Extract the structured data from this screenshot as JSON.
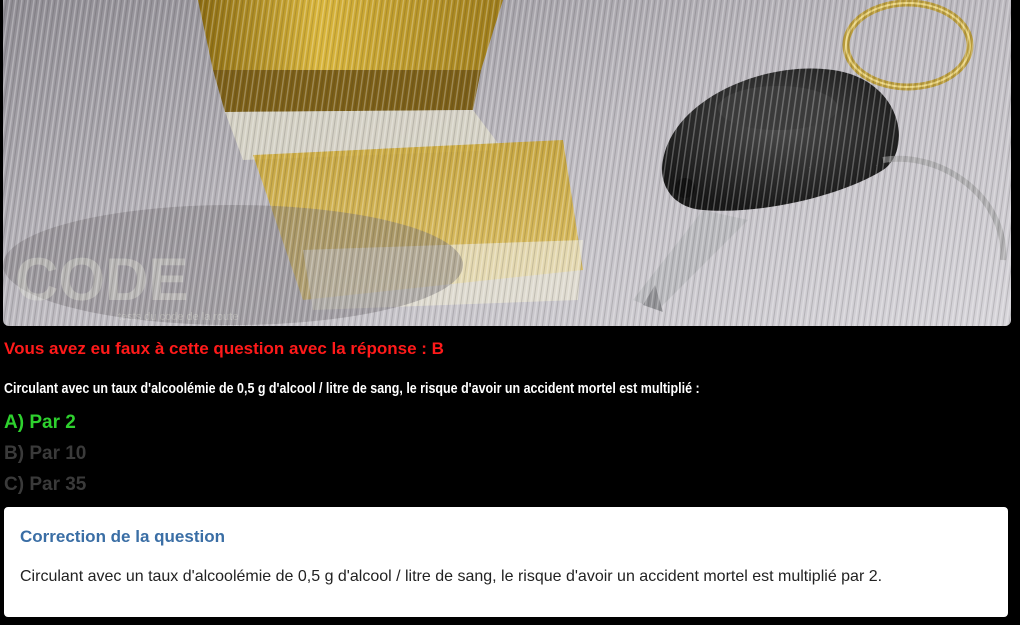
{
  "photo": {
    "description_icon": "drink-and-car-keys-image",
    "watermark_text": "CODE",
    "watermark_tagline": "tests du code de la route"
  },
  "result": {
    "message": "Vous avez eu faux à cette question avec la réponse : B",
    "color": "#ff1a1a"
  },
  "question": {
    "text": "Circulant avec un taux d'alcoolémie de 0,5 g d'alcool / litre de sang, le risque d'avoir un accident mortel est multiplié :"
  },
  "answers": [
    {
      "label": "A) Par 2",
      "state": "correct",
      "color": "#2ed12e"
    },
    {
      "label": "B) Par 10",
      "state": "wrong",
      "color": "#3a3a3a"
    },
    {
      "label": "C) Par 35",
      "state": "wrong",
      "color": "#3a3a3a"
    }
  ],
  "correction": {
    "title": "Correction de la question",
    "text": "Circulant avec un taux d'alcoolémie de 0,5 g d'alcool / litre de sang, le risque d'avoir un accident mortel est multiplié par 2.",
    "title_color": "#3a6ea5"
  }
}
